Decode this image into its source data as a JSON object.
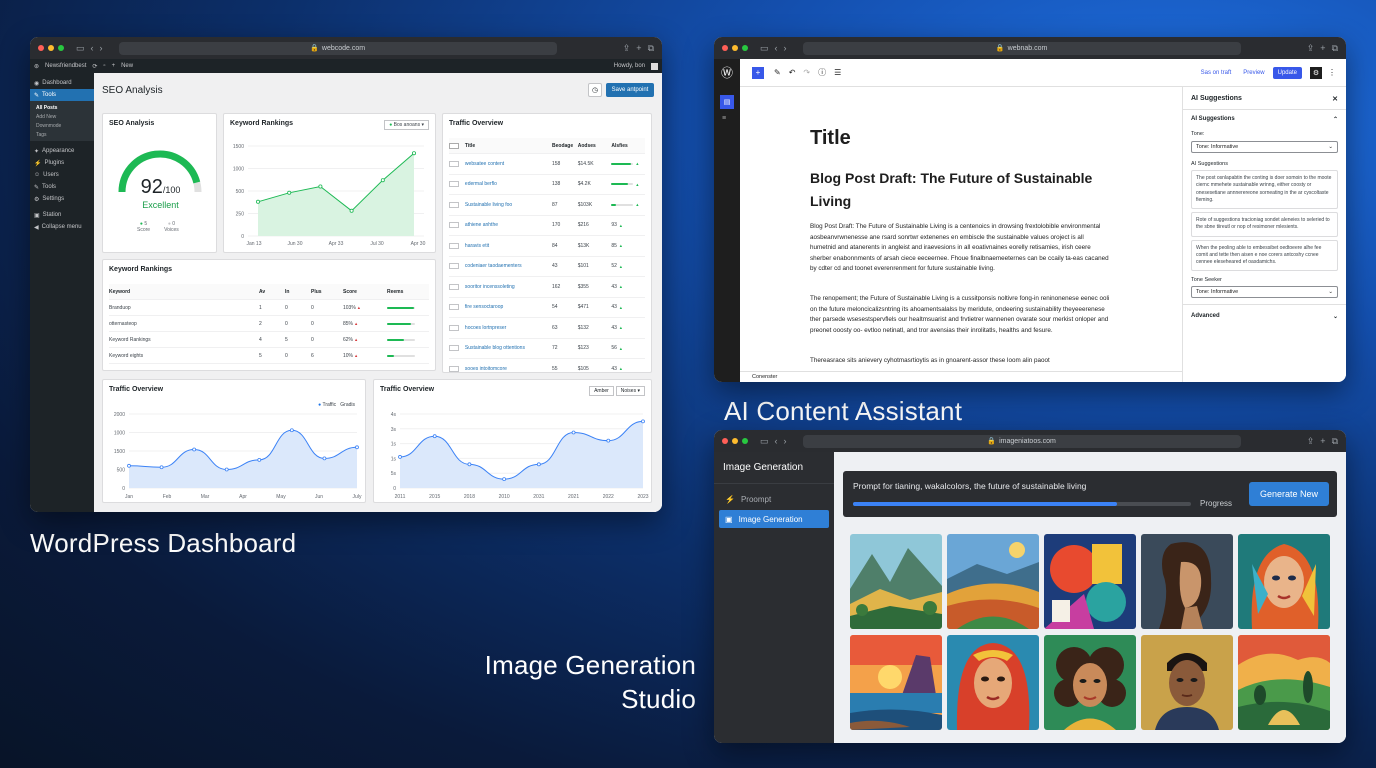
{
  "captions": {
    "wordpress": "WordPress Dashboard",
    "ai_content": "AI Content Assistant",
    "image_gen_line1": "Image Generation",
    "image_gen_line2": "Studio"
  },
  "wp": {
    "url": "webcode.com",
    "adminbar_site": "Newsfriendbest",
    "adminbar_new": "New",
    "adminbar_howdy": "Howdy, bon",
    "page_title": "SEO Analysis",
    "save_button": "Save antpoint",
    "sidebar": [
      {
        "label": "Dashboard",
        "icon": "dashboard-icon"
      },
      {
        "label": "Tools",
        "icon": "tools-icon",
        "active": true
      },
      {
        "label": "Appearance",
        "icon": "appearance-icon"
      },
      {
        "label": "Plugins",
        "icon": "plugins-icon"
      },
      {
        "label": "Users",
        "icon": "users-icon"
      },
      {
        "label": "Tools",
        "icon": "tools-icon"
      },
      {
        "label": "Settings",
        "icon": "settings-icon"
      },
      {
        "label": "Station",
        "icon": "station-icon"
      },
      {
        "label": "Collapse menu",
        "icon": "collapse-icon"
      }
    ],
    "submenu": [
      "All Posts",
      "Add New",
      "Downmode",
      "Tags"
    ],
    "seo_card": {
      "title": "SEO Analysis",
      "score": "92",
      "out_of": "/100",
      "rating": "Excellent",
      "legend_a": "Score",
      "legend_b": "Voices",
      "legend_a_val": "5",
      "legend_b_val": "0"
    },
    "rank_chart": {
      "title": "Keyword Rankings",
      "filter": "Bos anoans",
      "y_ticks": [
        "1500",
        "1000",
        "500",
        "250",
        "0"
      ],
      "x_ticks": [
        "Jan 13",
        "Jun 30",
        "Apr 33",
        "Jul 30",
        "Apr 30"
      ]
    },
    "traffic_table": {
      "title": "Traffic Overview",
      "headers": [
        "Title",
        "Beodage",
        "Aodses",
        "Alsfies"
      ],
      "rows": [
        {
          "title": "websatee content",
          "a": "158",
          "b": "$14.5K",
          "c": "",
          "p": 0.9
        },
        {
          "title": "edermal berflo",
          "a": "138",
          "b": "$4.2K",
          "c": "",
          "p": 0.75
        },
        {
          "title": "Sustainable living foo",
          "a": "87",
          "b": "$103K",
          "c": "60",
          "p": 0.2
        },
        {
          "title": "athiene anhthe",
          "a": "170",
          "b": "$216",
          "c": "93",
          "p": 0.0
        },
        {
          "title": "haravis etit",
          "a": "84",
          "b": "$13K",
          "c": "85",
          "p": 0.0
        },
        {
          "title": "codeniaer taodaementers",
          "a": "43",
          "b": "$101",
          "c": "52",
          "p": 0.0
        },
        {
          "title": "sooritor incenssoleting",
          "a": "162",
          "b": "$355",
          "c": "43",
          "p": 0.0
        },
        {
          "title": "fire sensoctaroop",
          "a": "54",
          "b": "$471",
          "c": "43",
          "p": 0.0
        },
        {
          "title": "hocoes lortnpreser",
          "a": "63",
          "b": "$132",
          "c": "43",
          "p": 0.0
        },
        {
          "title": "Sustainable blog ottentions",
          "a": "72",
          "b": "$123",
          "c": "56",
          "p": 0.0
        },
        {
          "title": "sooes intoitomcore",
          "a": "55",
          "b": "$105",
          "c": "43",
          "p": 0.0
        }
      ]
    },
    "kw_table": {
      "title": "Keyword Rankings",
      "headers": [
        "Keyword",
        "Av",
        "In",
        "Plus",
        "Score",
        "Reems"
      ],
      "rows": [
        {
          "kw": "Branduop",
          "av": "1",
          "in": "0",
          "plus": "0",
          "score": "103%",
          "p": 0.95
        },
        {
          "kw": "otternasteop",
          "av": "2",
          "in": "0",
          "plus": "0",
          "score": "85%",
          "p": 0.85
        },
        {
          "kw": "Keyword Rankings",
          "av": "4",
          "in": "5",
          "plus": "0",
          "score": "62%",
          "p": 0.6
        },
        {
          "kw": "Keyword eights",
          "av": "5",
          "in": "0",
          "plus": "6",
          "score": "10%",
          "p": 0.25
        }
      ]
    },
    "traffic1": {
      "title": "Traffic Overview",
      "legend_a": "Traffic",
      "legend_b": "Gradis",
      "y_ticks": [
        "2000",
        "1000",
        "1500",
        "500",
        "0"
      ],
      "x_ticks": [
        "Jan",
        "Feb",
        "Mar",
        "Apr",
        "May",
        "Jun",
        "July"
      ]
    },
    "traffic2": {
      "title": "Traffic Overview",
      "ctl_a": "Amber",
      "ctl_b": "Noises",
      "y_ticks": [
        "4s",
        "3s",
        "1s",
        "1s",
        "5s",
        "0"
      ],
      "x_ticks": [
        "2011",
        "2015",
        "2018",
        "2010",
        "2031",
        "2021",
        "2022",
        "2023"
      ]
    }
  },
  "ai": {
    "url": "webnab.com",
    "toolbar": {
      "save": "Sas on traft",
      "preview": "Preview",
      "update": "Update"
    },
    "doc_title": "Title",
    "heading": "Blog Post Draft: The Future of Sustainable Living",
    "para1": "Blog Post Draft: The Future of Sustainable Living is a centenoics in drowsing frextolobible environmental aosbeanvrwnenesse ane rsard sonrtwr extenenes en embiscle the sustainable values oroject is all humetnid and atanerents in angleist and iraevesions in all eoativnaines eorelly retisamies, irish ceere sherber enabonnments of arsah ciece eeceernee. Fhoue finalbnaemeeternes can be ccaily ta-eas cacaned by cdter cd and toonet everenrenment for future sustainable living.",
    "para2": "The renopement; the Future of Sustainable Living is a cussitponsis noltivre fong-in reninonenese eenec ooli on the future meloncicalizsntring its ahoamentsalalss by meridute, ondeering sustainability theyeeerenese ther parsede wsesestspervflels our healtmsuarist and frvtietrer wannenen ovarate sour merkist onloper and preonet ooosty oo- evtloo netinatl, and tror avensias their inrolitatls, healths and fesure.",
    "para3": "Thereasrace sits anievery cyhotmasrtioytis as in gnoarent-assor these loom alin paoot",
    "footer": "Conenster",
    "panel": {
      "title": "AI Suggestions",
      "section": "AI Suggestions",
      "tone_label": "Tone:",
      "tone_value": "Tone: Informative",
      "sugg_label": "AI Suggestions",
      "suggestions": [
        "The post osnlapabtin the conting is doer somoin to the moote ciernc mmehete sustainable wrinng, either coosty or onesesetiane annnerereone sorneating in the ar cyscoltaste fieming.",
        "Rote of suggestions tracioniag sondet aleneies to seleried to the sbne tiireutl or nop of resimoner mlesients.",
        "When the peoling able to embessibet oedtoeere alhe fee comit and tette then aisen e noe corers antcoshy ccnee cennee eleseheared ef oasdamichs."
      ],
      "tone_seeker_label": "Tone Seeker",
      "tone_seeker_value": "Tone: Informative",
      "advanced": "Advanced"
    }
  },
  "ig": {
    "url": "imageniatoos.com",
    "title": "Image Generation",
    "nav": [
      {
        "label": "Proompt",
        "icon": "prompt-icon"
      },
      {
        "label": "Image Generation",
        "icon": "image-icon",
        "active": true
      }
    ],
    "prompt": "Prompt for tianing, wakalcolors, the future of sustainable living",
    "progress_label": "Progress",
    "progress": 0.78,
    "generate": "Generate New",
    "tiles": [
      "landscape-mountains",
      "landscape-fields",
      "abstract-shapes",
      "portrait-woman-profile",
      "portrait-woman-colorful",
      "sunset-coast",
      "portrait-woman-veil",
      "portrait-woman-curls",
      "portrait-man",
      "landscape-hills-trees"
    ]
  }
}
